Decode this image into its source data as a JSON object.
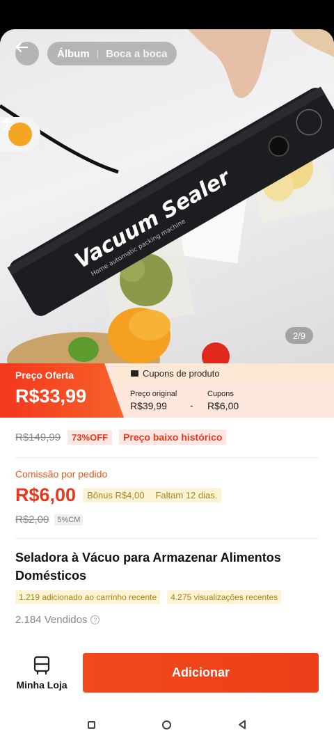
{
  "hero": {
    "tabs": {
      "album": "Álbum",
      "word_of_mouth": "Boca a boca"
    },
    "image_counter": "2/9",
    "product_brand_text": "Vacuum Sealer",
    "product_sub_text": "Home automatic packing machine"
  },
  "price": {
    "offer_label": "Preço Oferta",
    "offer_value": "R$33,99",
    "coupons_header": "Cupons de produto",
    "original_label": "Preço original",
    "original_value": "R$39,99",
    "separator": "-",
    "coupon_label": "Cupons",
    "coupon_value": "R$6,00"
  },
  "discount": {
    "old_price": "R$149,99",
    "percent_off": "73%OFF",
    "historic_low": "Preço baixo histórico"
  },
  "commission": {
    "label": "Comissão por pedido",
    "value": "R$6,00",
    "bonus": "Bônus R$4,00",
    "days_left": "Faltam 12 dias.",
    "old_value": "R$2,00",
    "rate": "5%CM"
  },
  "product": {
    "title": "Seladora à Vácuo para Armazenar Alimentos Domésticos",
    "added_to_cart": "1.219 adicionado ao carrinho recente",
    "recent_views": "4.275 visualizações recentes",
    "sold": "2.184 Vendidos",
    "help": "?"
  },
  "bottom": {
    "store_label": "Minha Loja",
    "add_button": "Adicionar"
  },
  "colors": {
    "accent": "#EF3E1A",
    "coupon_bg": "#FDE6DC",
    "bonus_text": "#A8831A"
  }
}
